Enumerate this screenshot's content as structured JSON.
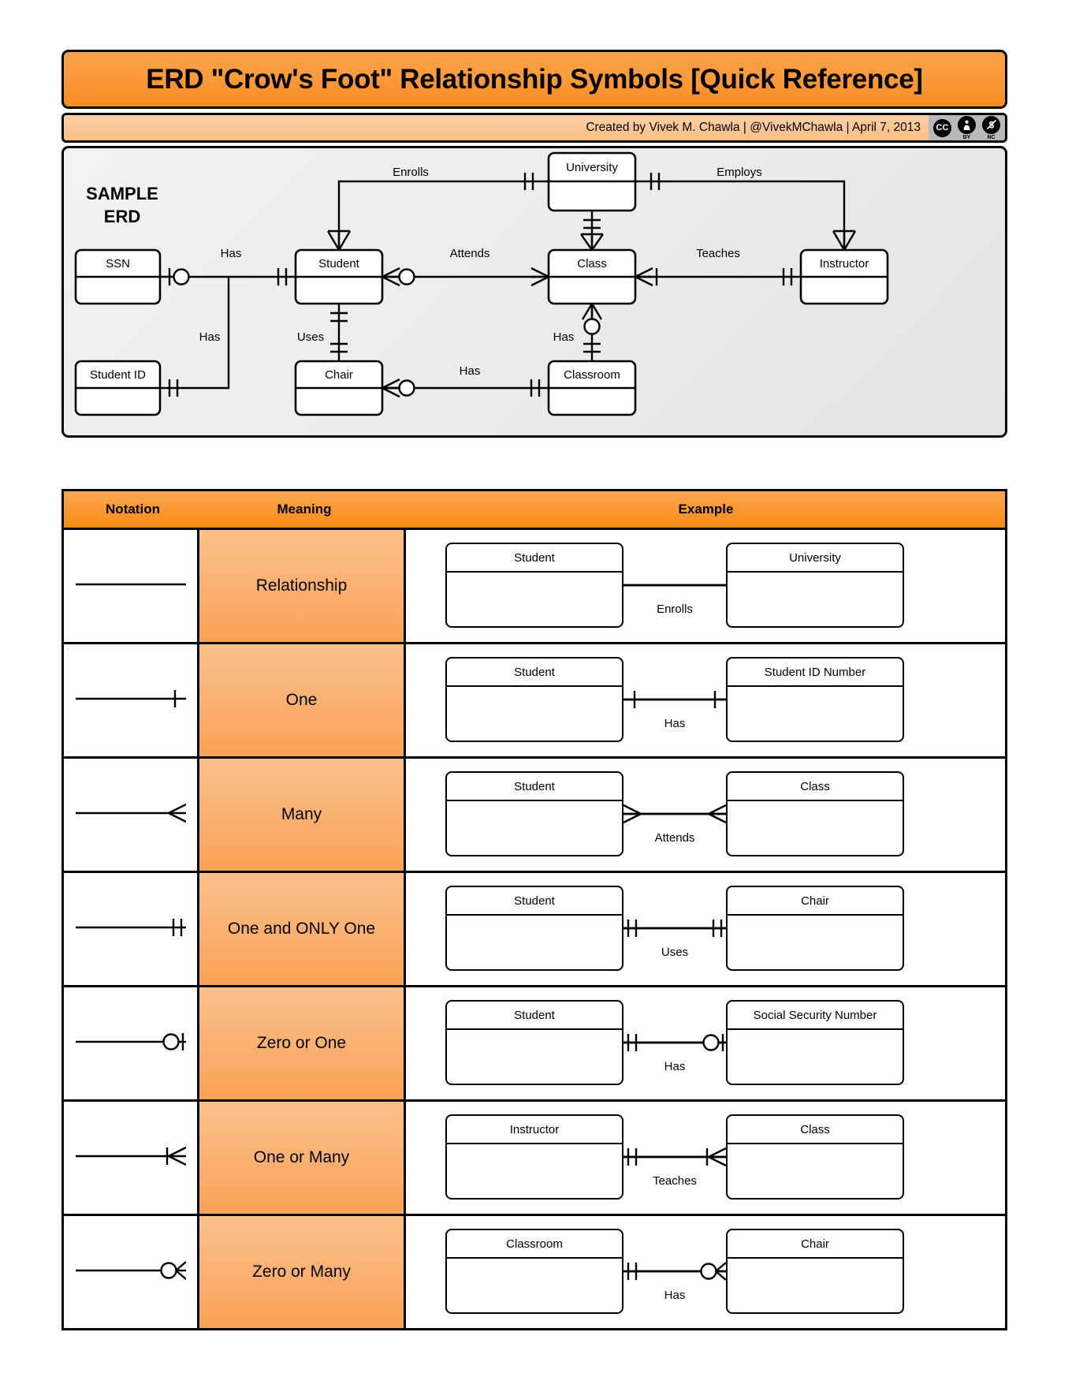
{
  "header": {
    "title": "ERD \"Crow's Foot\" Relationship Symbols [Quick Reference]",
    "credits": "Created by Vivek M. Chawla |  @VivekMChawla  |  April 7, 2013",
    "license_badges": [
      {
        "name": "cc-badge",
        "glyph": "CC",
        "sub": ""
      },
      {
        "name": "by-badge",
        "glyph": "ı",
        "sub": "BY"
      },
      {
        "name": "nc-badge",
        "glyph": "$",
        "sub": "NC"
      }
    ]
  },
  "sample_erd": {
    "label_line1": "SAMPLE",
    "label_line2": "ERD",
    "entities": [
      {
        "id": "ssn",
        "name": "SSN"
      },
      {
        "id": "student_id",
        "name": "Student ID"
      },
      {
        "id": "student",
        "name": "Student"
      },
      {
        "id": "chair",
        "name": "Chair"
      },
      {
        "id": "university",
        "name": "University"
      },
      {
        "id": "class",
        "name": "Class"
      },
      {
        "id": "classroom",
        "name": "Classroom"
      },
      {
        "id": "instructor",
        "name": "Instructor"
      }
    ],
    "relationships": [
      {
        "label": "Has",
        "from": "ssn",
        "to": "student",
        "from_symbol": "zero-or-one",
        "to_symbol": "one-and-only-one"
      },
      {
        "label": "Has",
        "from": "student_id",
        "to": "student",
        "from_symbol": "one-and-only-one",
        "to_symbol": "one-and-only-one"
      },
      {
        "label": "Enrolls",
        "from": "student",
        "to": "university",
        "from_symbol": "many",
        "to_symbol": "one-and-only-one"
      },
      {
        "label": "Attends",
        "from": "student",
        "to": "class",
        "from_symbol": "zero-or-many",
        "to_symbol": "many"
      },
      {
        "label": "Uses",
        "from": "student",
        "to": "chair",
        "from_symbol": "one-and-only-one",
        "to_symbol": "one-and-only-one"
      },
      {
        "label": "Employs",
        "from": "university",
        "to": "instructor",
        "from_symbol": "one-and-only-one",
        "to_symbol": "many"
      },
      {
        "label": "Teaches",
        "from": "class",
        "to": "instructor",
        "from_symbol": "many",
        "to_symbol": "one-and-only-one"
      },
      {
        "label": "Has",
        "from": "class",
        "to": "classroom",
        "from_symbol": "zero-or-many",
        "to_symbol": "one-and-only-one"
      },
      {
        "label": "Has",
        "from": "chair",
        "to": "classroom",
        "from_symbol": "zero-or-many",
        "to_symbol": "one-and-only-one"
      }
    ]
  },
  "table": {
    "columns": [
      "Notation",
      "Meaning",
      "Example"
    ],
    "rows": [
      {
        "notation": "relationship",
        "meaning": "Relationship",
        "example": {
          "left": "Student",
          "right": "University",
          "label": "Enrolls",
          "left_symbol": "none",
          "right_symbol": "none"
        }
      },
      {
        "notation": "one",
        "meaning": "One",
        "example": {
          "left": "Student",
          "right": "Student ID Number",
          "label": "Has",
          "left_symbol": "one",
          "right_symbol": "one"
        }
      },
      {
        "notation": "many",
        "meaning": "Many",
        "example": {
          "left": "Student",
          "right": "Class",
          "label": "Attends",
          "left_symbol": "many",
          "right_symbol": "many"
        }
      },
      {
        "notation": "one-and-only-one",
        "meaning": "One and ONLY One",
        "example": {
          "left": "Student",
          "right": "Chair",
          "label": "Uses",
          "left_symbol": "one-and-only-one",
          "right_symbol": "one-and-only-one"
        }
      },
      {
        "notation": "zero-or-one",
        "meaning": "Zero or One",
        "example": {
          "left": "Student",
          "right": "Social Security Number",
          "label": "Has",
          "left_symbol": "one-and-only-one",
          "right_symbol": "zero-or-one"
        }
      },
      {
        "notation": "one-or-many",
        "meaning": "One or Many",
        "example": {
          "left": "Instructor",
          "right": "Class",
          "label": "Teaches",
          "left_symbol": "one-and-only-one",
          "right_symbol": "one-or-many"
        }
      },
      {
        "notation": "zero-or-many",
        "meaning": "Zero or Many",
        "example": {
          "left": "Classroom",
          "right": "Chair",
          "label": "Has",
          "left_symbol": "one-and-only-one",
          "right_symbol": "zero-or-many"
        }
      }
    ]
  },
  "colors": {
    "orange_dark": "#f78b20",
    "orange_light": "#f9a14a",
    "meaning_fill": "#fbb173",
    "credits_fill": "#fcbe86",
    "panel_bg": "#ebebeb",
    "stroke": "#000000"
  }
}
